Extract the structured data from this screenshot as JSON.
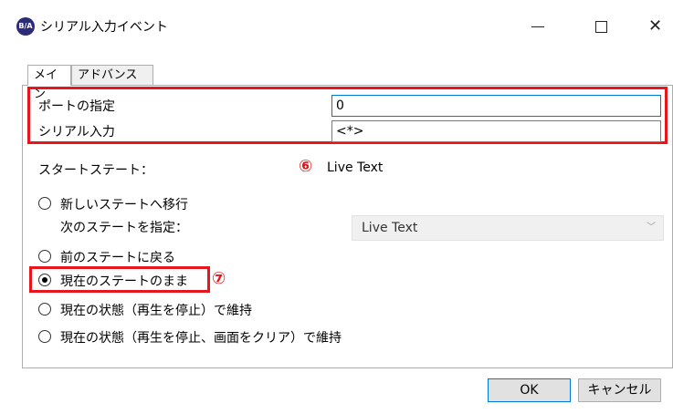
{
  "window": {
    "title": "シリアル入力イベント",
    "icon_text": "B/A",
    "minimize_icon": "minimize-icon",
    "maximize_icon": "maximize-icon",
    "close_icon": "close-icon"
  },
  "tabs": [
    {
      "label": "メイン",
      "active": true
    },
    {
      "label": "アドバンス",
      "active": false
    }
  ],
  "fields": {
    "port_label": "ポートの指定",
    "port_value": "0",
    "serial_label": "シリアル入力",
    "serial_value": "<*>"
  },
  "start_state": {
    "label": "スタートステート：",
    "annotation": "⑥",
    "value": "Live Text"
  },
  "radios": [
    {
      "label": "新しいステートへ移行",
      "checked": false
    },
    {
      "label": "前のステートに戻る",
      "checked": false
    },
    {
      "label": "現在のステートのまま",
      "checked": true
    },
    {
      "label": "現在の状態（再生を停止）で維持",
      "checked": false
    },
    {
      "label": "現在の状態（再生を停止、画面をクリア）で維持",
      "checked": false
    }
  ],
  "next_state": {
    "label": "次のステートを指定：",
    "selected": "Live Text"
  },
  "annotation_7": "⑦",
  "buttons": {
    "ok": "OK",
    "cancel": "キャンセル"
  },
  "colors": {
    "highlight_red": "#e8161c",
    "focus_blue": "#0078d7"
  }
}
